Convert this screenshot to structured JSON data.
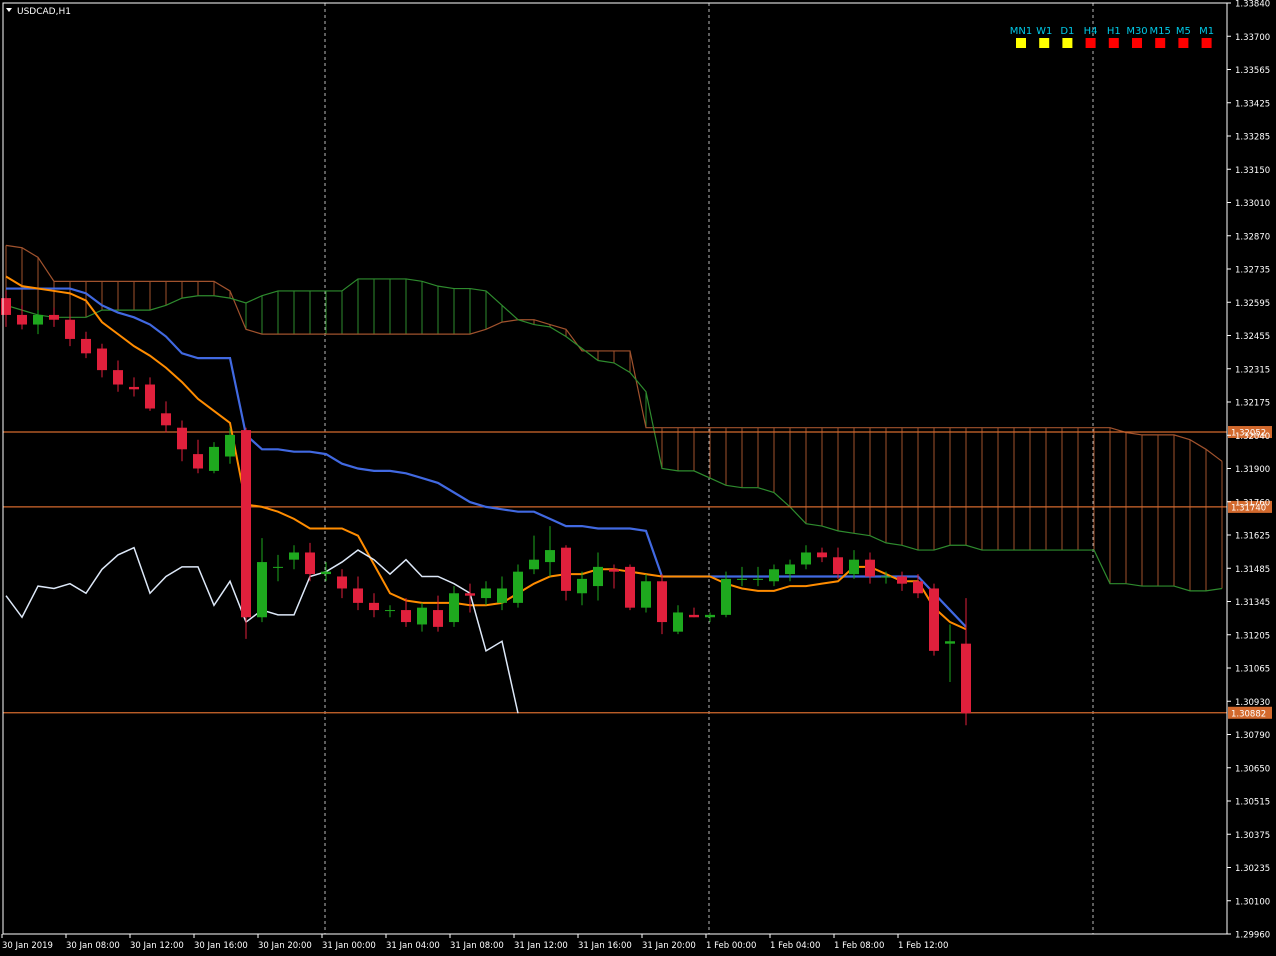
{
  "symbol": "USDCAD,H1",
  "colors": {
    "bg": "#000000",
    "axis": "#ffffff",
    "grid": "#ffffff",
    "bull": "#1ea81e",
    "bear": "#e0203c",
    "kijun": "#4169e1",
    "tenkan": "#ff8c00",
    "chikou": "#dde8f8",
    "spanA": "#2e8b2e",
    "spanB": "#a0522d",
    "hline": "#d2692d",
    "yellow": "#ffff00",
    "red": "#ff0000"
  },
  "timeframes": [
    {
      "label": "MN1",
      "state": "yellow"
    },
    {
      "label": "W1",
      "state": "yellow"
    },
    {
      "label": "D1",
      "state": "yellow"
    },
    {
      "label": "H4",
      "state": "red"
    },
    {
      "label": "H1",
      "state": "red"
    },
    {
      "label": "M30",
      "state": "red"
    },
    {
      "label": "M15",
      "state": "red"
    },
    {
      "label": "M5",
      "state": "red"
    },
    {
      "label": "M1",
      "state": "red"
    }
  ],
  "chart_data": {
    "type": "candlestick",
    "ylim": [
      1.2996,
      1.3384
    ],
    "y_ticks": [
      "1.33840",
      "1.33700",
      "1.33565",
      "1.33425",
      "1.33285",
      "1.33150",
      "1.33010",
      "1.32870",
      "1.32735",
      "1.32595",
      "1.32455",
      "1.32315",
      "1.32175",
      "1.32040",
      "1.31900",
      "1.31760",
      "1.31625",
      "1.31485",
      "1.31345",
      "1.31205",
      "1.31065",
      "1.30930",
      "1.30790",
      "1.30650",
      "1.30515",
      "1.30375",
      "1.30235",
      "1.30100",
      "1.29960"
    ],
    "x_labels": [
      "30 Jan 2019",
      "30 Jan 08:00",
      "30 Jan 12:00",
      "30 Jan 16:00",
      "30 Jan 20:00",
      "31 Jan 00:00",
      "31 Jan 04:00",
      "31 Jan 08:00",
      "31 Jan 12:00",
      "31 Jan 16:00",
      "31 Jan 20:00",
      "1 Feb 00:00",
      "1 Feb 04:00",
      "1 Feb 08:00",
      "1 Feb 12:00"
    ],
    "x_label_index": [
      0,
      4,
      8,
      12,
      16,
      20,
      24,
      28,
      32,
      36,
      40,
      44,
      48,
      52,
      56
    ],
    "period_separators": [
      20,
      44,
      68
    ],
    "visible_bars": 76,
    "horizontal_levels": [
      {
        "value": 1.32052,
        "label": "1.32052"
      },
      {
        "value": 1.3174,
        "label": "1.31740"
      },
      {
        "value": 1.30882,
        "label": "1.30882"
      }
    ],
    "candles": [
      [
        1.3261,
        1.3264,
        1.3249,
        1.3254
      ],
      [
        1.3254,
        1.3258,
        1.3248,
        1.325
      ],
      [
        1.325,
        1.3256,
        1.3246,
        1.3254
      ],
      [
        1.3254,
        1.3257,
        1.3249,
        1.3252
      ],
      [
        1.3252,
        1.3254,
        1.3241,
        1.3244
      ],
      [
        1.3244,
        1.3247,
        1.3236,
        1.3238
      ],
      [
        1.324,
        1.3242,
        1.3228,
        1.3231
      ],
      [
        1.3231,
        1.3235,
        1.3222,
        1.3225
      ],
      [
        1.3224,
        1.3228,
        1.322,
        1.3223
      ],
      [
        1.3225,
        1.3228,
        1.3214,
        1.3215
      ],
      [
        1.3213,
        1.3218,
        1.3205,
        1.3208
      ],
      [
        1.3207,
        1.321,
        1.3193,
        1.3198
      ],
      [
        1.3196,
        1.3202,
        1.3188,
        1.319
      ],
      [
        1.3189,
        1.3201,
        1.3188,
        1.3199
      ],
      [
        1.3195,
        1.3207,
        1.3192,
        1.3204
      ],
      [
        1.3206,
        1.3207,
        1.3119,
        1.3128
      ],
      [
        1.3128,
        1.3161,
        1.3126,
        1.3151
      ],
      [
        1.3149,
        1.3154,
        1.3143,
        1.3149
      ],
      [
        1.3152,
        1.3158,
        1.3148,
        1.3155
      ],
      [
        1.3155,
        1.3159,
        1.3143,
        1.3146
      ],
      [
        1.3146,
        1.3151,
        1.3143,
        1.3147
      ],
      [
        1.3145,
        1.3148,
        1.3136,
        1.314
      ],
      [
        1.314,
        1.3145,
        1.3131,
        1.3134
      ],
      [
        1.3134,
        1.3138,
        1.3128,
        1.3131
      ],
      [
        1.3131,
        1.3133,
        1.3128,
        1.3131
      ],
      [
        1.3131,
        1.3136,
        1.3124,
        1.3126
      ],
      [
        1.3125,
        1.3134,
        1.3122,
        1.3132
      ],
      [
        1.3131,
        1.3137,
        1.3122,
        1.3124
      ],
      [
        1.3126,
        1.3141,
        1.3124,
        1.3138
      ],
      [
        1.3138,
        1.3142,
        1.313,
        1.3137
      ],
      [
        1.3136,
        1.3143,
        1.3133,
        1.314
      ],
      [
        1.3134,
        1.3145,
        1.3131,
        1.314
      ],
      [
        1.3134,
        1.315,
        1.3132,
        1.3147
      ],
      [
        1.3148,
        1.3162,
        1.3146,
        1.3152
      ],
      [
        1.3151,
        1.3166,
        1.3145,
        1.3156
      ],
      [
        1.3157,
        1.3158,
        1.3135,
        1.3139
      ],
      [
        1.3138,
        1.3147,
        1.3133,
        1.3144
      ],
      [
        1.3141,
        1.3155,
        1.3135,
        1.3149
      ],
      [
        1.3148,
        1.315,
        1.314,
        1.3147
      ],
      [
        1.3149,
        1.315,
        1.3131,
        1.3132
      ],
      [
        1.3132,
        1.3146,
        1.313,
        1.3143
      ],
      [
        1.3143,
        1.3146,
        1.3121,
        1.3126
      ],
      [
        1.3122,
        1.3133,
        1.3121,
        1.313
      ],
      [
        1.3129,
        1.3132,
        1.3128,
        1.3128
      ],
      [
        1.3128,
        1.313,
        1.3126,
        1.3129
      ],
      [
        1.3129,
        1.3147,
        1.3128,
        1.3144
      ],
      [
        1.3144,
        1.3149,
        1.3141,
        1.3144
      ],
      [
        1.3144,
        1.3149,
        1.3141,
        1.3144
      ],
      [
        1.3143,
        1.315,
        1.3141,
        1.3148
      ],
      [
        1.3146,
        1.3152,
        1.3143,
        1.315
      ],
      [
        1.315,
        1.3158,
        1.3148,
        1.3155
      ],
      [
        1.3155,
        1.3157,
        1.3151,
        1.3153
      ],
      [
        1.3153,
        1.3157,
        1.3144,
        1.3146
      ],
      [
        1.3146,
        1.3156,
        1.3144,
        1.3152
      ],
      [
        1.3152,
        1.3155,
        1.3142,
        1.3145
      ],
      [
        1.3145,
        1.3147,
        1.3142,
        1.3145
      ],
      [
        1.3145,
        1.3147,
        1.3139,
        1.3142
      ],
      [
        1.3143,
        1.3146,
        1.3136,
        1.3138
      ],
      [
        1.314,
        1.3142,
        1.3112,
        1.3114
      ],
      [
        1.3117,
        1.3125,
        1.3101,
        1.3118
      ],
      [
        1.3117,
        1.3136,
        1.3083,
        1.3088
      ]
    ],
    "kijun": [
      1.3265,
      1.3265,
      1.3265,
      1.3265,
      1.3265,
      1.3263,
      1.3258,
      1.3255,
      1.3253,
      1.325,
      1.3245,
      1.3238,
      1.3236,
      1.3236,
      1.3236,
      1.3204,
      1.3198,
      1.3198,
      1.3197,
      1.3197,
      1.3196,
      1.3192,
      1.319,
      1.3189,
      1.3189,
      1.3188,
      1.3186,
      1.3184,
      1.318,
      1.3176,
      1.3174,
      1.3173,
      1.3172,
      1.3172,
      1.3169,
      1.3166,
      1.3166,
      1.3165,
      1.3165,
      1.3165,
      1.3164,
      1.3145,
      1.3145,
      1.3145,
      1.3145,
      1.3145,
      1.3145,
      1.3145,
      1.3145,
      1.3145,
      1.3145,
      1.3145,
      1.3145,
      1.3145,
      1.3145,
      1.3145,
      1.3145,
      1.3145,
      1.3138,
      1.3131,
      1.3124
    ],
    "tenkan": [
      1.327,
      1.3266,
      1.3265,
      1.3264,
      1.3263,
      1.326,
      1.3251,
      1.3246,
      1.3241,
      1.3237,
      1.3232,
      1.3226,
      1.3219,
      1.3214,
      1.3209,
      1.3175,
      1.3174,
      1.3172,
      1.3169,
      1.3165,
      1.3165,
      1.3165,
      1.3162,
      1.315,
      1.3138,
      1.3135,
      1.3134,
      1.3134,
      1.3134,
      1.3133,
      1.3133,
      1.3134,
      1.3138,
      1.3142,
      1.3145,
      1.3146,
      1.3146,
      1.3148,
      1.3148,
      1.3147,
      1.3146,
      1.3145,
      1.3145,
      1.3145,
      1.3145,
      1.3142,
      1.314,
      1.3139,
      1.3139,
      1.3141,
      1.3141,
      1.3142,
      1.3143,
      1.3149,
      1.3149,
      1.3146,
      1.3143,
      1.3143,
      1.3132,
      1.3126,
      1.3123
    ],
    "chikou": [
      [
        0,
        1.3137
      ],
      [
        1,
        1.3128
      ],
      [
        2,
        1.3141
      ],
      [
        3,
        1.314
      ],
      [
        4,
        1.3142
      ],
      [
        5,
        1.3138
      ],
      [
        6,
        1.3148
      ],
      [
        7,
        1.3154
      ],
      [
        8,
        1.3157
      ],
      [
        9,
        1.3138
      ],
      [
        10,
        1.3145
      ],
      [
        11,
        1.3149
      ],
      [
        12,
        1.3149
      ],
      [
        13,
        1.3133
      ],
      [
        14,
        1.3143
      ],
      [
        15,
        1.3126
      ],
      [
        16,
        1.3131
      ],
      [
        17,
        1.3129
      ],
      [
        18,
        1.3129
      ],
      [
        19,
        1.3145
      ],
      [
        20,
        1.3147
      ],
      [
        21,
        1.3151
      ],
      [
        22,
        1.3156
      ],
      [
        23,
        1.3152
      ],
      [
        24,
        1.3146
      ],
      [
        25,
        1.3152
      ],
      [
        26,
        1.3145
      ],
      [
        27,
        1.3145
      ],
      [
        28,
        1.3142
      ],
      [
        29,
        1.3138
      ],
      [
        30,
        1.3114
      ],
      [
        31,
        1.3118
      ],
      [
        32,
        1.3088
      ]
    ],
    "span_a": [
      1.3258,
      1.3256,
      1.3254,
      1.3253,
      1.3253,
      1.3253,
      1.3256,
      1.3256,
      1.3256,
      1.3256,
      1.3258,
      1.3261,
      1.3262,
      1.3262,
      1.3261,
      1.3259,
      1.3262,
      1.3264,
      1.3264,
      1.3264,
      1.3264,
      1.3264,
      1.3269,
      1.3269,
      1.3269,
      1.3269,
      1.3268,
      1.3266,
      1.3265,
      1.3265,
      1.3264,
      1.3258,
      1.3252,
      1.325,
      1.3249,
      1.3245,
      1.324,
      1.3235,
      1.3234,
      1.323,
      1.3222,
      1.319,
      1.3189,
      1.3189,
      1.3186,
      1.3183,
      1.3182,
      1.3182,
      1.318,
      1.3174,
      1.3167,
      1.3166,
      1.3164,
      1.3163,
      1.3162,
      1.3159,
      1.3158,
      1.3156,
      1.3156,
      1.3158,
      1.3158,
      1.3156,
      1.3156,
      1.3156,
      1.3156,
      1.3156,
      1.3156,
      1.3156,
      1.3156,
      1.3142,
      1.3142,
      1.3141,
      1.3141,
      1.3141,
      1.3139,
      1.3139,
      1.314
    ],
    "span_b": [
      1.3283,
      1.3282,
      1.3278,
      1.3268,
      1.3268,
      1.3268,
      1.3268,
      1.3268,
      1.3268,
      1.3268,
      1.3268,
      1.3268,
      1.3268,
      1.3268,
      1.3264,
      1.3248,
      1.3246,
      1.3246,
      1.3246,
      1.3246,
      1.3246,
      1.3246,
      1.3246,
      1.3246,
      1.3246,
      1.3246,
      1.3246,
      1.3246,
      1.3246,
      1.3246,
      1.3248,
      1.3251,
      1.3252,
      1.3252,
      1.325,
      1.3248,
      1.3239,
      1.3239,
      1.3239,
      1.3239,
      1.3207,
      1.3207,
      1.3207,
      1.3207,
      1.3207,
      1.3207,
      1.3207,
      1.3207,
      1.3207,
      1.3207,
      1.3207,
      1.3207,
      1.3207,
      1.3207,
      1.3207,
      1.3207,
      1.3207,
      1.3207,
      1.3207,
      1.3207,
      1.3207,
      1.3207,
      1.3207,
      1.3207,
      1.3207,
      1.3207,
      1.3207,
      1.3207,
      1.3207,
      1.3207,
      1.3205,
      1.3204,
      1.3204,
      1.3204,
      1.3202,
      1.3198,
      1.3193
    ]
  }
}
